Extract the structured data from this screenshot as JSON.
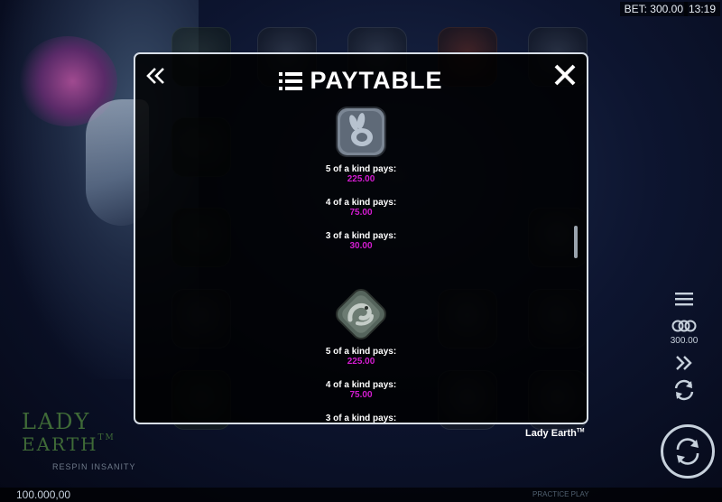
{
  "header": {
    "bet_text": "BET: 300.00",
    "time_text": "13:19"
  },
  "paytable": {
    "title": "PAYTABLE",
    "entries": [
      {
        "symbol_icon": "rabbit-stone-icon",
        "pays": [
          {
            "label": "5 of a kind pays:",
            "value": "225.00"
          },
          {
            "label": "4 of a kind pays:",
            "value": "75.00"
          },
          {
            "label": "3 of a kind pays:",
            "value": "30.00"
          }
        ]
      },
      {
        "symbol_icon": "lizard-stone-icon",
        "pays": [
          {
            "label": "5 of a kind pays:",
            "value": "225.00"
          },
          {
            "label": "4 of a kind pays:",
            "value": "75.00"
          },
          {
            "label": "3 of a kind pays:",
            "value": ""
          }
        ]
      }
    ]
  },
  "game_name": "Lady Earth",
  "game_name_tm": "TM",
  "logo": {
    "line1": "LADY",
    "line2": "EARTH",
    "tm": "TM",
    "provider": "RESPIN INSANITY"
  },
  "side": {
    "coin_value": "300.00"
  },
  "footer": {
    "balance": "100.000,00",
    "right_label": "PRACTICE PLAY"
  },
  "colors": {
    "pay_value": "#d21ccf",
    "panel_border": "#d8dfe8",
    "logo_green": "#3f6a37"
  }
}
